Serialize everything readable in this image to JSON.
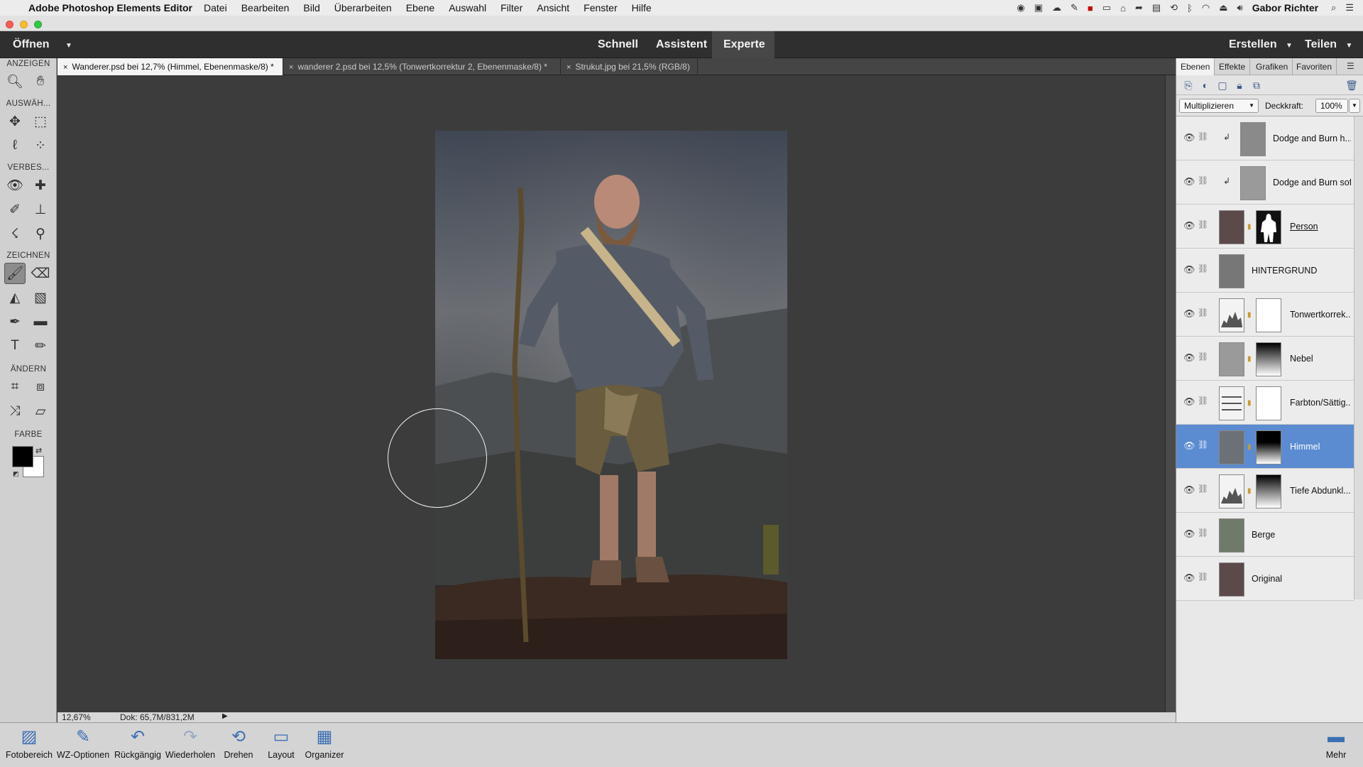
{
  "menubar": {
    "app_name": "Adobe Photoshop Elements Editor",
    "items": [
      "Datei",
      "Bearbeiten",
      "Bild",
      "Überarbeiten",
      "Ebene",
      "Auswahl",
      "Filter",
      "Ansicht",
      "Fenster",
      "Hilfe"
    ],
    "user": "Gabor Richter"
  },
  "header": {
    "open_label": "Öffnen",
    "modes": [
      "Schnell",
      "Assistent",
      "Experte"
    ],
    "active_mode": "Experte",
    "create_label": "Erstellen",
    "share_label": "Teilen"
  },
  "toolbox": {
    "sections": [
      "ANZEIGEN",
      "AUSWÄH...",
      "VERBES...",
      "ZEICHNEN",
      "ÄNDERN",
      "FARBE"
    ],
    "foreground_color": "#000000",
    "background_color": "#ffffff"
  },
  "doc_tabs": [
    "Wanderer.psd bei 12,7% (Himmel, Ebenenmaske/8) *",
    "wanderer 2.psd bei 12,5% (Tonwertkorrektur 2, Ebenenmaske/8) *",
    "Strukut.jpg bei 21,5% (RGB/8)"
  ],
  "status": {
    "zoom": "12,67%",
    "doc_size": "Dok: 65,7M/831,2M"
  },
  "panel": {
    "tabs": [
      "Ebenen",
      "Effekte",
      "Grafiken",
      "Favoriten"
    ],
    "active_tab": "Ebenen",
    "blend_mode": "Multiplizieren",
    "opacity_label": "Deckkraft:",
    "opacity_value": "100%",
    "layers": [
      {
        "name": "Dodge and Burn h...",
        "selected": false
      },
      {
        "name": "Dodge and Burn soft",
        "selected": false
      },
      {
        "name": "Person",
        "selected": false
      },
      {
        "name": "HINTERGRUND",
        "selected": false
      },
      {
        "name": "Tonwertkorrek...",
        "selected": false
      },
      {
        "name": "Nebel",
        "selected": false
      },
      {
        "name": "Farbton/Sättig...",
        "selected": false
      },
      {
        "name": "Himmel",
        "selected": true
      },
      {
        "name": "Tiefe Abdunkl...",
        "selected": false
      },
      {
        "name": "Berge",
        "selected": false
      },
      {
        "name": "Original",
        "selected": false
      }
    ]
  },
  "taskbar": {
    "buttons": [
      "Fotobereich",
      "WZ-Optionen",
      "Rückgängig",
      "Wiederholen",
      "Drehen",
      "Layout",
      "Organizer"
    ],
    "more_label": "Mehr"
  },
  "colors": {
    "accent_selection": "#5b8bd0",
    "icon_blue": "#3b6fb5"
  }
}
